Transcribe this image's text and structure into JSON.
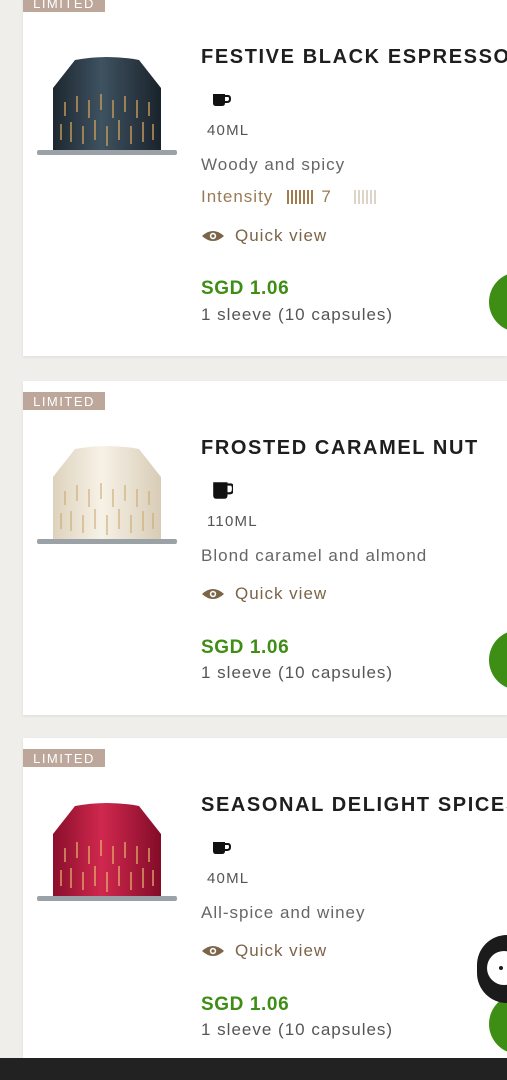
{
  "products": [
    {
      "badge": "LIMITED",
      "title": "FESTIVE BLACK ESPRESSO",
      "cup_icon": "espresso-cup-icon",
      "volume": "40ML",
      "description": "Woody and spicy",
      "intensity_label": "Intensity",
      "intensity_value": "7",
      "intensity_max": 13,
      "quick_view": "Quick view",
      "price": "SGD 1.06",
      "pack": "1 sleeve (10 capsules)",
      "capsule_color": "#2f3c48"
    },
    {
      "badge": "LIMITED",
      "title": "FROSTED CARAMEL NUT",
      "cup_icon": "coffee-cup-icon",
      "volume": "110ML",
      "description": "Blond caramel and almond",
      "quick_view": "Quick view",
      "price": "SGD 1.06",
      "pack": "1 sleeve (10 capsules)",
      "capsule_color": "#efe7d6"
    },
    {
      "badge": "LIMITED",
      "title": "SEASONAL DELIGHT SPICES",
      "cup_icon": "espresso-cup-icon",
      "volume": "40ML",
      "description": "All-spice and winey",
      "quick_view": "Quick view",
      "price": "SGD 1.06",
      "pack": "1 sleeve (10 capsules)",
      "capsule_color": "#b3173a"
    }
  ],
  "colors": {
    "price": "#3e8d14",
    "badge": "#bda79a",
    "quick_view": "#7b6448",
    "intensity": "#a17c4e"
  }
}
